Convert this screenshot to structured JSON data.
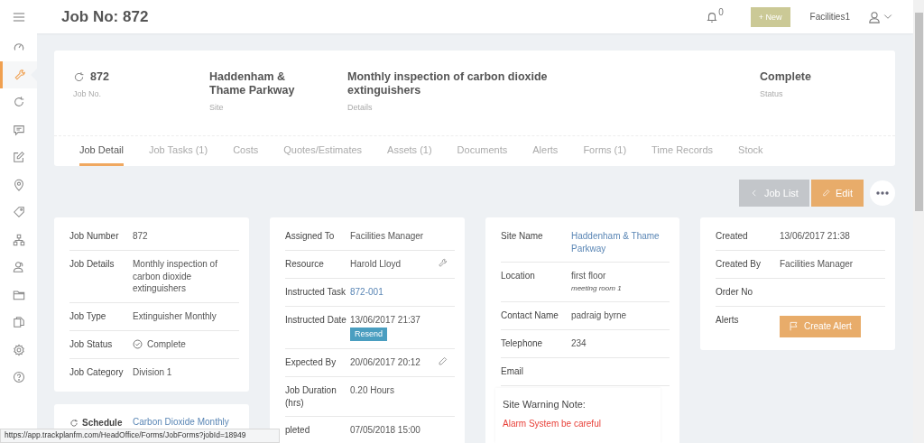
{
  "header": {
    "title": "Job No: 872",
    "notification_count": "0",
    "new_button": "+ New",
    "user": "Facilities1"
  },
  "sidebar": {
    "items": [
      {
        "selected": false
      },
      {
        "selected": true
      },
      {
        "selected": false
      },
      {
        "selected": false
      },
      {
        "selected": false
      },
      {
        "selected": false
      },
      {
        "selected": false
      },
      {
        "selected": false
      },
      {
        "selected": false
      },
      {
        "selected": false
      },
      {
        "selected": false
      },
      {
        "selected": false
      },
      {
        "selected": false
      }
    ]
  },
  "summary": {
    "fields": [
      {
        "value": "872",
        "label": "Job No."
      },
      {
        "value": "Haddenham & Thame Parkway",
        "label": "Site"
      },
      {
        "value": "Monthly inspection of carbon dioxide extinguishers",
        "label": "Details"
      },
      {
        "value": "Complete",
        "label": "Status"
      }
    ]
  },
  "tabs": [
    {
      "label": "Job Detail",
      "selected": true
    },
    {
      "label": "Job Tasks (1)",
      "selected": false
    },
    {
      "label": "Costs",
      "selected": false
    },
    {
      "label": "Quotes/Estimates",
      "selected": false
    },
    {
      "label": "Assets (1)",
      "selected": false
    },
    {
      "label": "Documents",
      "selected": false
    },
    {
      "label": "Alerts",
      "selected": false
    },
    {
      "label": "Forms (1)",
      "selected": false
    },
    {
      "label": "Time Records",
      "selected": false
    },
    {
      "label": "Stock",
      "selected": false
    }
  ],
  "actions": {
    "back": "Job List",
    "edit": "Edit"
  },
  "cards": [
    {
      "rows": [
        {
          "kind": "text",
          "label": "Job Number",
          "value": "872"
        },
        {
          "kind": "text",
          "label": "Job Details",
          "value": "Monthly inspection of carbon dioxide extinguishers"
        },
        {
          "kind": "text",
          "label": "Job Type",
          "value": "Extinguisher Monthly"
        },
        {
          "kind": "status",
          "label": "Job Status",
          "value": "Complete"
        },
        {
          "kind": "text",
          "label": "Job Category",
          "value": "Division 1"
        }
      ]
    },
    {
      "rows": [
        {
          "kind": "text",
          "label": "Assigned To",
          "value": "Facilities Manager"
        },
        {
          "kind": "tool",
          "label": "Resource",
          "value": "Harold Lloyd"
        },
        {
          "kind": "link",
          "label": "Instructed Task",
          "value": "872-001"
        },
        {
          "kind": "resend",
          "label": "Instructed Date",
          "value": "13/06/2017 21:37",
          "action": "Resend"
        },
        {
          "kind": "editable",
          "label": "Expected By",
          "value": "20/06/2017 20:12"
        },
        {
          "kind": "text",
          "label": "Job Duration (hrs)",
          "value": "0.20 Hours"
        },
        {
          "kind": "text",
          "label": "pleted",
          "value": "07/05/2018 15:00"
        }
      ]
    },
    {
      "rows": [
        {
          "kind": "link",
          "label": "Site Name",
          "value": "Haddenham & Thame Parkway"
        },
        {
          "kind": "location",
          "label": "Location",
          "value": "first floor",
          "sub": "meeting room 1"
        },
        {
          "kind": "text",
          "label": "Contact Name",
          "value": "padraig byrne"
        },
        {
          "kind": "text",
          "label": "Telephone",
          "value": "234"
        },
        {
          "kind": "text",
          "label": "Email",
          "value": ""
        }
      ],
      "warning": {
        "title": "Site Warning Note:",
        "text": "Alarm System be careful"
      }
    },
    {
      "rows": [
        {
          "kind": "text",
          "label": "Created",
          "value": "13/06/2017 21:38"
        },
        {
          "kind": "text",
          "label": "Created By",
          "value": "Facilities Manager"
        },
        {
          "kind": "text",
          "label": "Order No",
          "value": ""
        },
        {
          "kind": "alert",
          "label": "Alerts",
          "action": "Create Alert"
        }
      ]
    }
  ],
  "schedule": {
    "label": "Schedule",
    "value": "Carbon Dioxide Monthly"
  },
  "status_url": "https://app.trackplanfm.com/HeadOffice/Forms/JobForms?jobId=18949"
}
